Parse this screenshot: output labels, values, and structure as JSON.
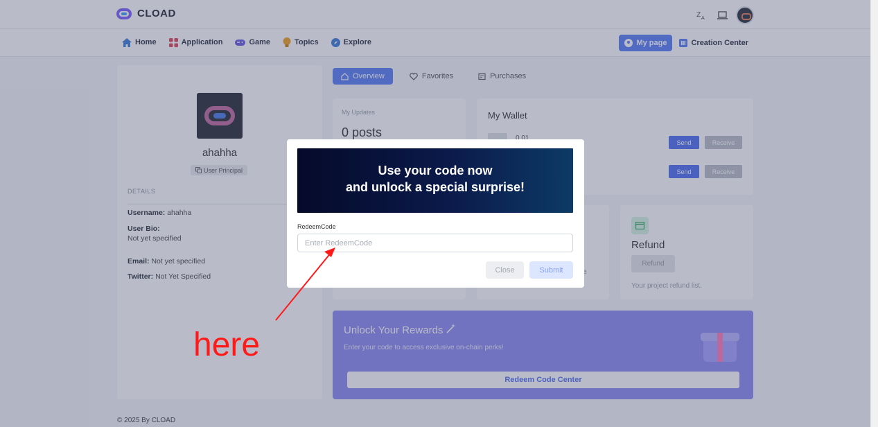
{
  "header": {
    "brand": "CLOAD",
    "icons": [
      "translate-icon",
      "monitor-icon",
      "avatar"
    ]
  },
  "nav": {
    "items": [
      {
        "label": "Home",
        "icon": "home-icon",
        "color": "#3b7bd9"
      },
      {
        "label": "Application",
        "icon": "grid-icon",
        "color": "#e0455a"
      },
      {
        "label": "Game",
        "icon": "gamepad-icon",
        "color": "#6b5ae0"
      },
      {
        "label": "Topics",
        "icon": "bulb-icon",
        "color": "#f0a020"
      },
      {
        "label": "Explore",
        "icon": "compass-icon",
        "color": "#3b7bd9"
      }
    ],
    "mypage": "My page",
    "creation": "Creation Center"
  },
  "profile": {
    "name": "ahahha",
    "badge": "User Principal",
    "details_heading": "DETAILS",
    "username_label": "Username:",
    "username": "ahahha",
    "bio_label": "User Bio:",
    "bio": "Not yet specified",
    "email_label": "Email:",
    "email": "Not yet specified",
    "twitter_label": "Twitter:",
    "twitter": "Not Yet Specified"
  },
  "tabs": [
    "Overview",
    "Favorites",
    "Purchases"
  ],
  "updates": {
    "label": "My Updates",
    "count": "0 posts"
  },
  "wallet": {
    "title": "My Wallet",
    "balance": "0.01",
    "send": "Send",
    "receive": "Receive"
  },
  "refund": {
    "title": "Refund",
    "button": "Refund",
    "desc": "Your project refund list."
  },
  "partial_card_text": "e",
  "rewards": {
    "title": "Unlock Your Rewards",
    "subtitle": "Enter your code to access exclusive on-chain perks!",
    "button": "Redeem Code Center"
  },
  "footer": "© 2025 By CLOAD",
  "modal": {
    "banner_line1": "Use your code now",
    "banner_line2": "and unlock a special surprise!",
    "field_label": "RedeemCode",
    "placeholder": "Enter RedeemCode",
    "value": "",
    "close": "Close",
    "submit": "Submit"
  },
  "annotation": {
    "text": "here",
    "color": "#ff1a1a"
  }
}
